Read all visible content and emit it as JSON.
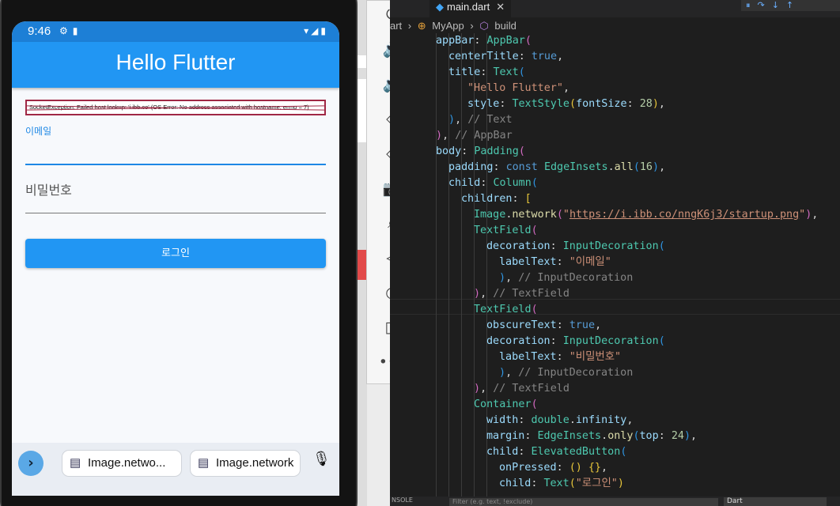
{
  "phone": {
    "status_time": "9:46",
    "appbar_title": "Hello Flutter",
    "error_text": "SocketException: Failed host lookup: 'i.ibb.co' (OS Error: No address associated with hostname, errno = 7)",
    "email_label": "이메일",
    "password_label": "비밀번호",
    "login_label": "로그인",
    "suggestions": [
      "Image.netwo...",
      "Image.network"
    ]
  },
  "editor": {
    "tab_title": "main.dart",
    "breadcrumbs": [
      "art",
      "MyApp",
      "build"
    ],
    "bottom_label": "NSOLE",
    "filter_placeholder": "Filter (e.g. text, !exclude)",
    "dropdown_value": "Dart"
  },
  "colors": {
    "accent": "#2196f3",
    "statusbar": "#1d7fd6",
    "error_border": "#a02845",
    "editor_bg": "#1e1e1e"
  },
  "icons": [
    "power-icon",
    "volume-up-icon",
    "volume-down-icon",
    "rotate-left-icon",
    "rotate-right-icon",
    "camera-icon",
    "zoom-icon",
    "back-icon",
    "home-icon",
    "overview-icon",
    "more-icon"
  ]
}
